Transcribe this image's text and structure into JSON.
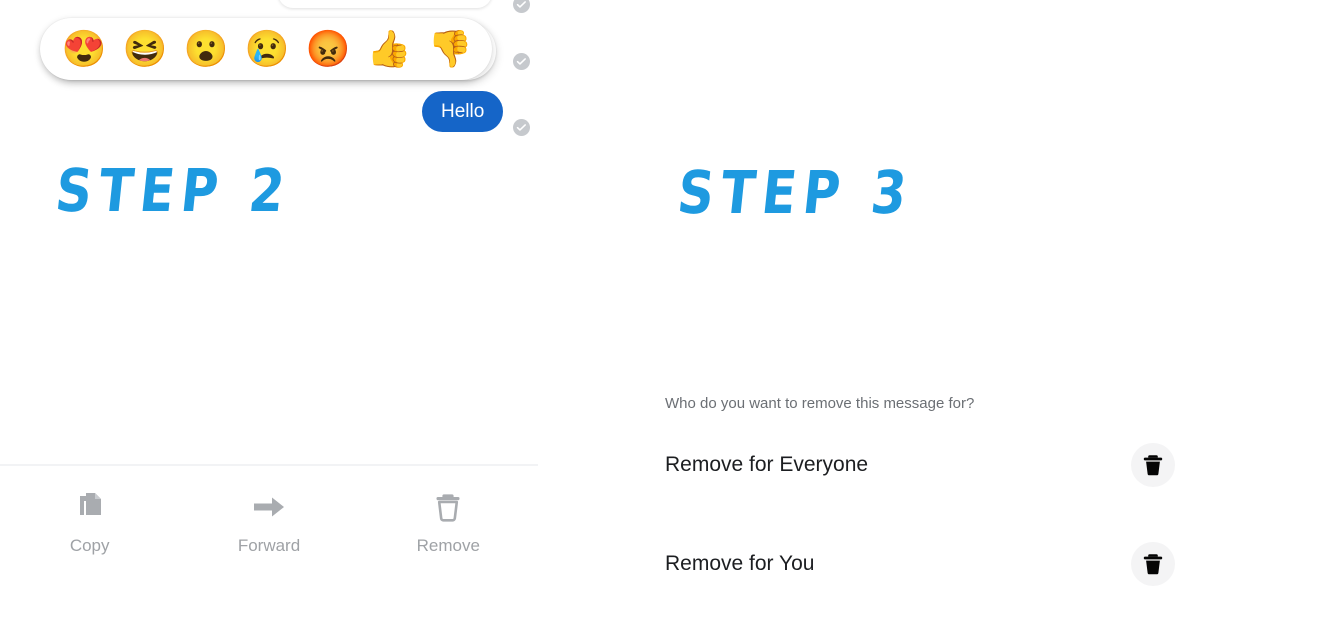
{
  "step_left": {
    "heading": "STEP 2",
    "message_bubble": {
      "text": "Hello"
    },
    "reactions": [
      {
        "name": "heart-eyes-emoji",
        "glyph": "😍",
        "label": "Love"
      },
      {
        "name": "laughing-emoji",
        "glyph": "😆",
        "label": "Haha"
      },
      {
        "name": "surprised-emoji",
        "glyph": "😮",
        "label": "Wow"
      },
      {
        "name": "crying-emoji",
        "glyph": "😢",
        "label": "Sad"
      },
      {
        "name": "angry-emoji",
        "glyph": "😡",
        "label": "Angry"
      },
      {
        "name": "thumbs-up-emoji",
        "glyph": "👍",
        "label": "Like"
      },
      {
        "name": "thumbs-down-emoji",
        "glyph": "👎",
        "label": "Dislike"
      }
    ],
    "actions": [
      {
        "name": "copy-action",
        "icon": "copy-icon",
        "label": "Copy"
      },
      {
        "name": "forward-action",
        "icon": "arrow-right-icon",
        "label": "Forward"
      },
      {
        "name": "remove-action",
        "icon": "trash-icon",
        "label": "Remove"
      }
    ],
    "delivery_status": {
      "icon": "check-circle-icon",
      "count": 3
    }
  },
  "step_right": {
    "heading": "STEP 3",
    "question": "Who do you want to remove this message for?",
    "options": [
      {
        "name": "remove-for-everyone",
        "label": "Remove for Everyone",
        "icon": "trash-icon"
      },
      {
        "name": "remove-for-you",
        "label": "Remove for You",
        "icon": "trash-icon"
      }
    ]
  },
  "colors": {
    "step_accent": "#1e9ae0",
    "bubble_blue": "#1565c8",
    "bubble_text": "#ffffff",
    "icon_gray": "#a9acb0",
    "label_gray": "#9fa2a6",
    "question_gray": "#6b6f74",
    "option_text": "#1c1e21",
    "divider": "#f2f3f5",
    "check_badge": "#c6c9cd",
    "trash_circle_bg": "#f4f4f5",
    "background": "#ffffff"
  }
}
